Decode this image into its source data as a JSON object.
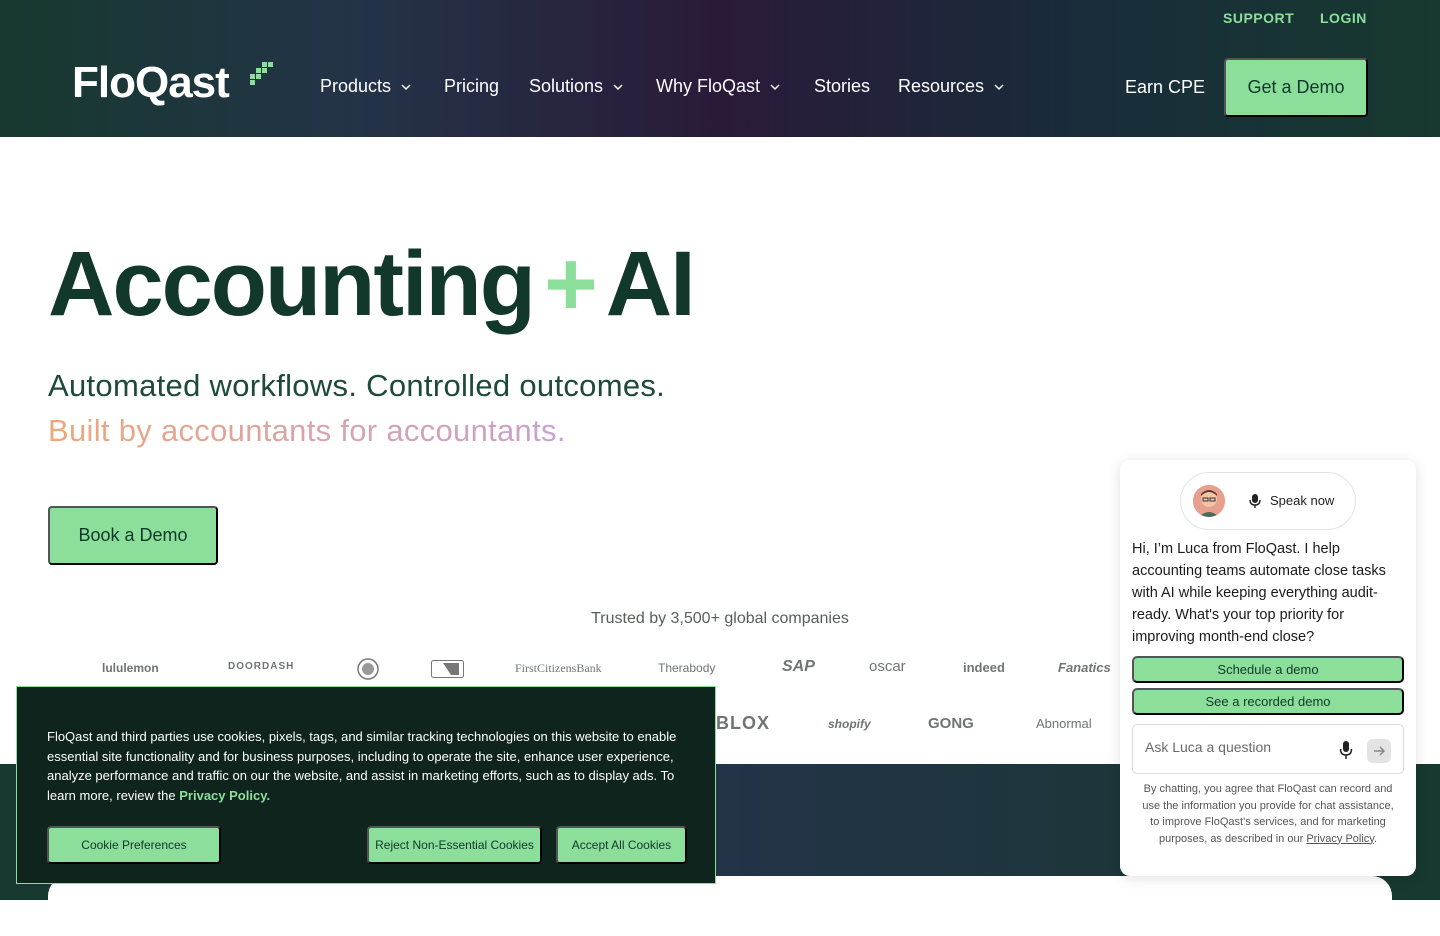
{
  "header": {
    "utility_links": [
      "SUPPORT",
      "LOGIN"
    ],
    "logo_text": "FloQast",
    "nav": [
      {
        "label": "Products",
        "has_dropdown": true
      },
      {
        "label": "Pricing",
        "has_dropdown": false
      },
      {
        "label": "Solutions",
        "has_dropdown": true
      },
      {
        "label": "Why FloQast",
        "has_dropdown": true
      },
      {
        "label": "Stories",
        "has_dropdown": false
      },
      {
        "label": "Resources",
        "has_dropdown": true
      }
    ],
    "earn_cpe": "Earn CPE",
    "get_demo": "Get a Demo"
  },
  "hero": {
    "title_left": "Accounting",
    "title_plus": "+",
    "title_right": "AI",
    "subtitle_1": "Automated workflows. Controlled outcomes.",
    "subtitle_2": "Built by accountants for accountants.",
    "cta": "Book a Demo"
  },
  "trusted": {
    "heading": "Trusted by 3,500+ global companies",
    "row1": [
      "lululemon",
      "DOORDASH",
      "",
      "",
      "FirstCitizensBank",
      "Therabody",
      "SAP",
      "oscar",
      "indeed",
      "Fanatics"
    ],
    "row2": [
      "BLOX",
      "shopify",
      "GONG",
      "Abnormal"
    ]
  },
  "cookie_banner": {
    "text": "FloQast and third parties use cookies, pixels, tags, and similar tracking technologies on this website to enable essential site functionality and for business purposes, including to operate the site, enhance user experience, analyze performance and traffic on our the website, and assist in marketing efforts, such as to display ads. To learn more, review the",
    "privacy_link": "Privacy Policy.",
    "buttons": {
      "preferences": "Cookie Preferences",
      "reject": "Reject Non-Essential Cookies",
      "accept": "Accept All Cookies"
    }
  },
  "chat": {
    "speak_now": "Speak now",
    "message": "Hi, I’m Luca from FloQast. I help accounting teams automate close tasks with AI while keeping everything audit-ready. What's your top priority for improving month-end close?",
    "options": [
      "Schedule a demo",
      "See a recorded demo"
    ],
    "input_placeholder": "Ask Luca a question",
    "disclaimer_prefix": "By chatting, you agree that FloQast can record and use the information you provide for chat assistance, to improve FloQast's services, and for marketing purposes, as described in our",
    "disclaimer_link": "Privacy Policy",
    "disclaimer_suffix": "."
  },
  "colors": {
    "brand_green": "#8bdf9a",
    "dark_green": "#12382c",
    "header_purple": "#2a1a3a"
  }
}
